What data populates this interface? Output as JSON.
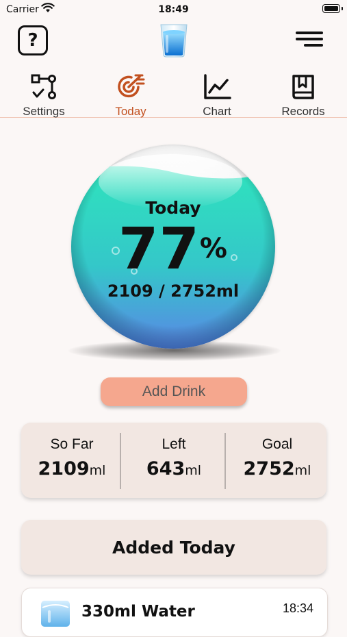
{
  "status_bar": {
    "carrier": "Carrier",
    "time": "18:49"
  },
  "header": {
    "help_icon": "question-mark-icon",
    "logo_icon": "water-glass-icon",
    "menu_icon": "hamburger-menu-icon"
  },
  "tabs": [
    {
      "label": "Settings",
      "icon": "settings-flow-icon",
      "active": false
    },
    {
      "label": "Today",
      "icon": "target-icon",
      "active": true
    },
    {
      "label": "Chart",
      "icon": "line-chart-icon",
      "active": false
    },
    {
      "label": "Records",
      "icon": "book-icon",
      "active": false
    }
  ],
  "orb": {
    "title": "Today",
    "percent": "77",
    "percent_sign": "%",
    "amount": "2109 / 2752ml",
    "fill_fraction": 0.77
  },
  "add_drink_label": "Add Drink",
  "stats": {
    "so_far": {
      "label": "So Far",
      "value": "2109",
      "unit": "ml"
    },
    "left": {
      "label": "Left",
      "value": "643",
      "unit": "ml"
    },
    "goal": {
      "label": "Goal",
      "value": "2752",
      "unit": "ml"
    }
  },
  "added_today_label": "Added Today",
  "records": [
    {
      "name": "330ml Water",
      "time": "18:34",
      "icon": "water-glass-icon"
    }
  ],
  "colors": {
    "accent": "#c2501f",
    "button": "#f5a78e",
    "card": "#f2e7e2",
    "water_top": "#2fe3bd",
    "water_bottom": "#5a86e6"
  }
}
